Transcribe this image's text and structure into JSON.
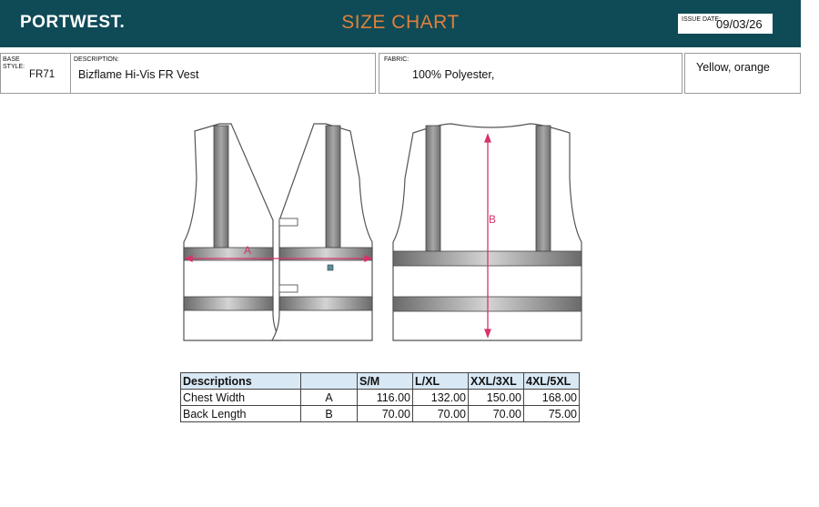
{
  "header": {
    "brand": "PORTWEST.",
    "title": "SIZE CHART",
    "issue_label": "ISSUE DATE:",
    "issue_date": "09/03/26"
  },
  "info": {
    "base_style_label": "BASE STYLE:",
    "base_style": "FR71",
    "description_label": "DESCRIPTION:",
    "description": "Bizflame Hi-Vis FR Vest",
    "fabric_label": "FABRIC:",
    "fabric": "100% Polyester,",
    "colours": "Yellow, orange"
  },
  "diagram": {
    "front_marker": "A",
    "back_marker": "B",
    "measure_color": "#d6336c"
  },
  "table": {
    "headers": [
      "Descriptions",
      "",
      "S/M",
      "L/XL",
      "XXL/3XL",
      "4XL/5XL"
    ],
    "rows": [
      [
        "Chest Width",
        "A",
        "116.00",
        "132.00",
        "150.00",
        "168.00"
      ],
      [
        "Back Length",
        "B",
        "70.00",
        "70.00",
        "70.00",
        "75.00"
      ]
    ]
  },
  "colors": {
    "header_bg": "#0f4a57",
    "title": "#e0803a",
    "table_header_bg": "#d9e8f5"
  }
}
